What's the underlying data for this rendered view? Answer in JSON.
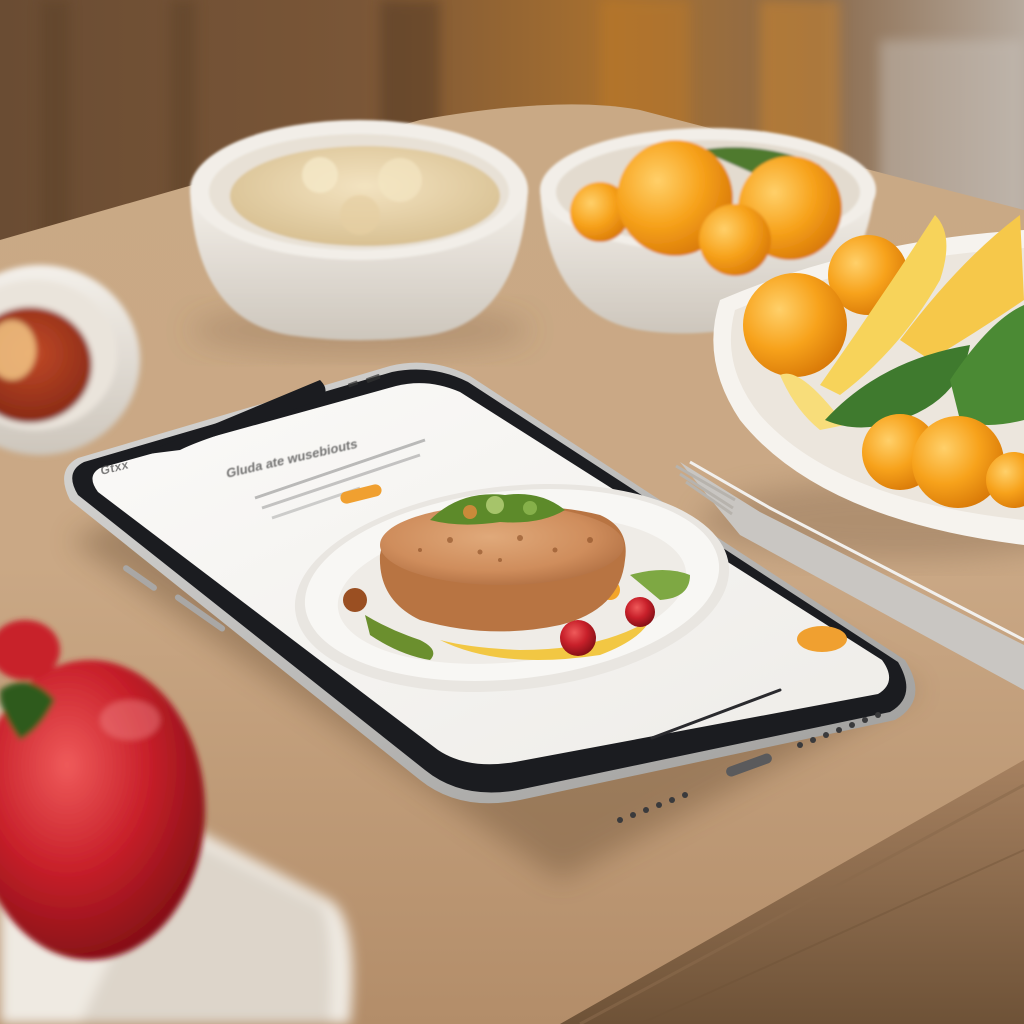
{
  "photo": {
    "subject": "smartphone lying on a wooden table showing a food app, surrounded by bowls of food",
    "colors": {
      "table": "#c8a682",
      "wall": "#6b4a2e",
      "screen": "#f6f5f2",
      "phone_frame": "#1b1c20",
      "accent_orange": "#f0a030",
      "orange_fruit": "#f6a21b",
      "tomato": "#c8202a",
      "sauce": "#a8321e",
      "mash": "#ead7b0"
    }
  },
  "phone": {
    "status_label": "Gtxx",
    "title": "Gluda ate wusebiouts",
    "body_lines": 3,
    "pill_color": "#f0a030",
    "action_button_color": "#f0a030",
    "dish": "grilled patty on a white plate with salad, tomato and sauce"
  },
  "icons": [
    "fork-icon",
    "home-indicator-icon"
  ]
}
